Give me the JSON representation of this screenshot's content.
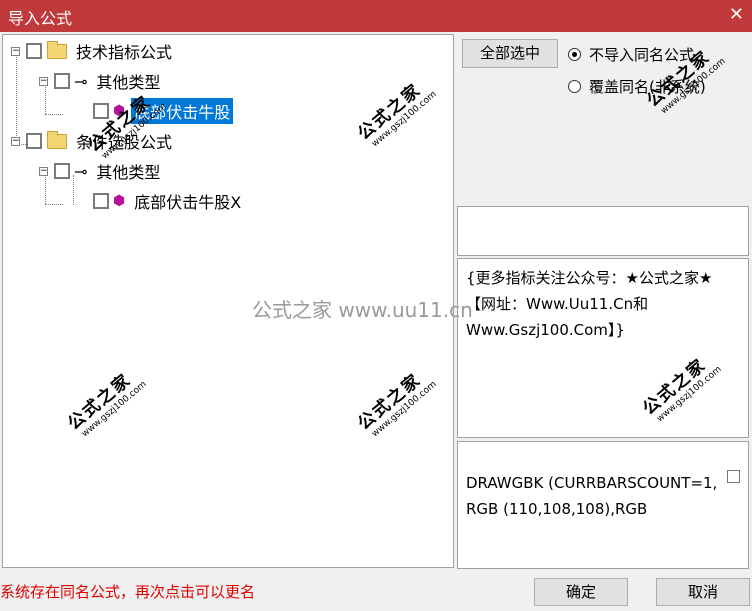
{
  "window": {
    "title": "导入公式",
    "close_glyph": "✕"
  },
  "tree": [
    {
      "label": "技术指标公式",
      "expander": "−"
    },
    {
      "label": "其他类型",
      "expander": "−"
    },
    {
      "label": "底部伏击牛股",
      "selected": true
    },
    {
      "label": "条件选股公式",
      "expander": "−"
    },
    {
      "label": "其他类型",
      "expander": "−"
    },
    {
      "label": "底部伏击牛股X"
    }
  ],
  "buttons": {
    "select_all": "全部选中",
    "ok": "确定",
    "cancel": "取消"
  },
  "options": [
    {
      "label": "不导入同名公式",
      "selected": true
    },
    {
      "label": "覆盖同名(非系统)",
      "selected": false
    }
  ],
  "description": "{更多指标关注公众号：★公式之家★ 【网址：Www.Uu11.Cn和Www.Gszj100.Com】}",
  "code_preview": "DRAWGBK (CURRBARSCOUNT=1, RGB (110,108,108),RGB",
  "status": "系统存在同名公式，再次点击可以更名",
  "watermark": {
    "text": "公式之家",
    "url": "www.gszj100.com",
    "center": "公式之家 www.uu11.cn"
  },
  "icons": {
    "folder": "folder-icon",
    "key": "key-icon",
    "formula": "gem-icon"
  },
  "colors": {
    "titlebar": "#c0393b",
    "selection": "#0078d7",
    "status_text": "#e00000"
  }
}
